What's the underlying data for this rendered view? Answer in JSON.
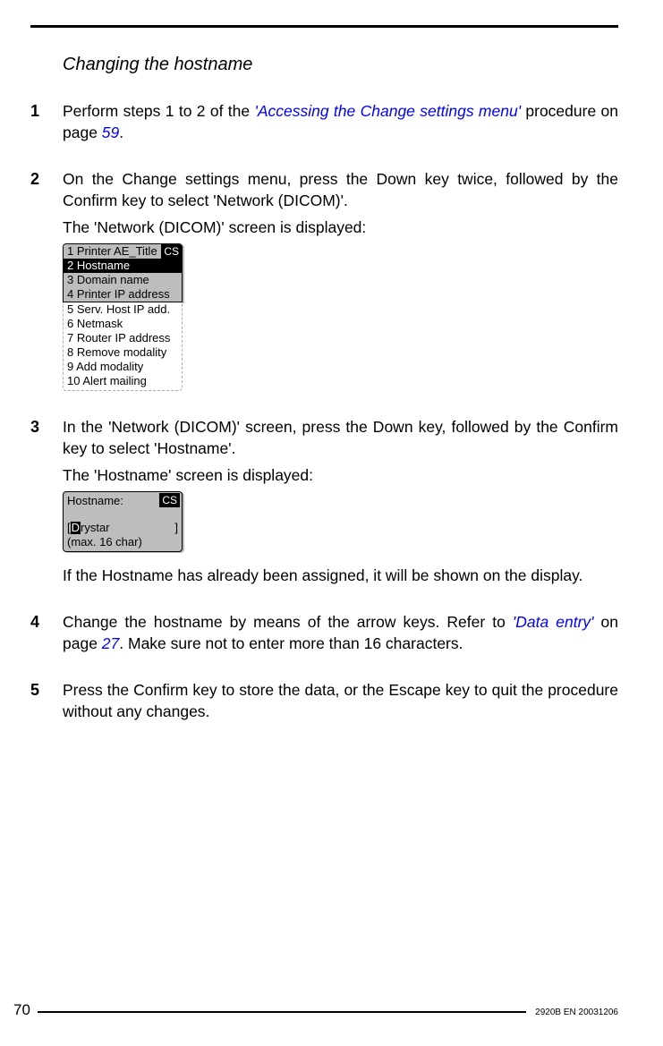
{
  "title": "Changing the hostname",
  "steps": {
    "s1": {
      "num": "1",
      "pre": "Perform steps 1 to 2 of the ",
      "link": "'Accessing the Change settings menu'",
      "mid": " procedure on page ",
      "pageref": "59",
      "post": "."
    },
    "s2": {
      "num": "2",
      "p1": "On the Change settings menu, press the Down key twice, followed by the Confirm key to select 'Network (DICOM)'.",
      "p2": "The 'Network (DICOM)' screen is displayed:"
    },
    "s3": {
      "num": "3",
      "p1": "In the 'Network (DICOM)' screen, press the Down key, followed by the Confirm key to select 'Hostname'.",
      "p2": "The 'Hostname' screen is displayed:",
      "p3": "If the Hostname has already been assigned, it will be shown on the display."
    },
    "s4": {
      "num": "4",
      "pre": "Change the hostname by means of the arrow keys. Refer to ",
      "link": "'Data entry'",
      "mid": " on page ",
      "pageref": "27",
      "post": ". Make sure not to enter more than 16 characters."
    },
    "s5": {
      "num": "5",
      "p1": "Press the Confirm key to store the data, or the Escape key to quit the procedure without any changes."
    }
  },
  "lcd_network": {
    "cs": "CS",
    "items": [
      "1 Printer AE_Title",
      "2 Hostname",
      "3 Domain name",
      "4 Printer IP address",
      "5 Serv. Host IP add.",
      "6 Netmask",
      "7 Router IP address",
      "8 Remove modality",
      "9 Add modality",
      "10 Alert mailing"
    ]
  },
  "lcd_hostname": {
    "cs": "CS",
    "label": "Hostname:",
    "value_open": "[",
    "cursor": "D",
    "value_rest": "rystar",
    "value_close": "]",
    "hint": "(max. 16 char)"
  },
  "footer": {
    "page": "70",
    "code": "2920B EN 20031206"
  }
}
